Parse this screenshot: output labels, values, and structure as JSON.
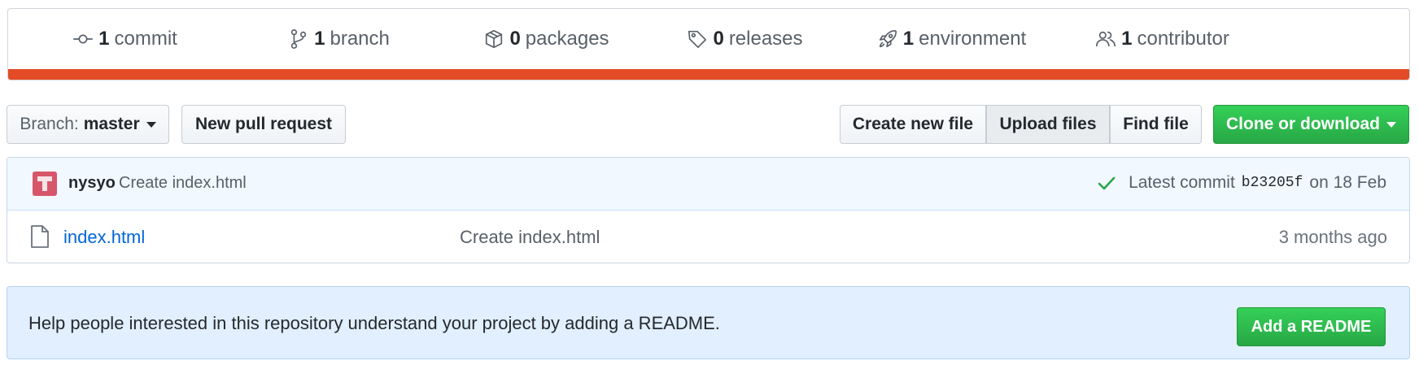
{
  "summary": {
    "commits": {
      "count": "1",
      "label": "commit",
      "icon": "commit-icon"
    },
    "branches": {
      "count": "1",
      "label": "branch",
      "icon": "branch-icon"
    },
    "packages": {
      "count": "0",
      "label": "packages",
      "icon": "package-icon"
    },
    "releases": {
      "count": "0",
      "label": "releases",
      "icon": "tag-icon"
    },
    "environments": {
      "count": "1",
      "label": "environment",
      "icon": "rocket-icon"
    },
    "contributors": {
      "count": "1",
      "label": "contributor",
      "icon": "people-icon"
    },
    "language_bar_color": "#e34c26"
  },
  "toolbar": {
    "branch_label": "Branch:",
    "branch_value": "master",
    "new_pull_request": "New pull request",
    "create_new_file": "Create new file",
    "upload_files": "Upload files",
    "find_file": "Find file",
    "clone_or_download": "Clone or download"
  },
  "latest_commit": {
    "author": "nysyo",
    "message": "Create index.html",
    "prefix": "Latest commit",
    "sha": "b23205f",
    "date": "on 18 Feb",
    "status_icon": "check-icon"
  },
  "files": [
    {
      "name": "index.html",
      "commit_message": "Create index.html",
      "age": "3 months ago",
      "icon": "file-icon"
    }
  ],
  "readme_prompt": {
    "text": "Help people interested in this repository understand your project by adding a README.",
    "button": "Add a README"
  },
  "colors": {
    "accent_green": "#28a745",
    "link_blue": "#0366d6",
    "readme_bg": "#e1effe"
  }
}
